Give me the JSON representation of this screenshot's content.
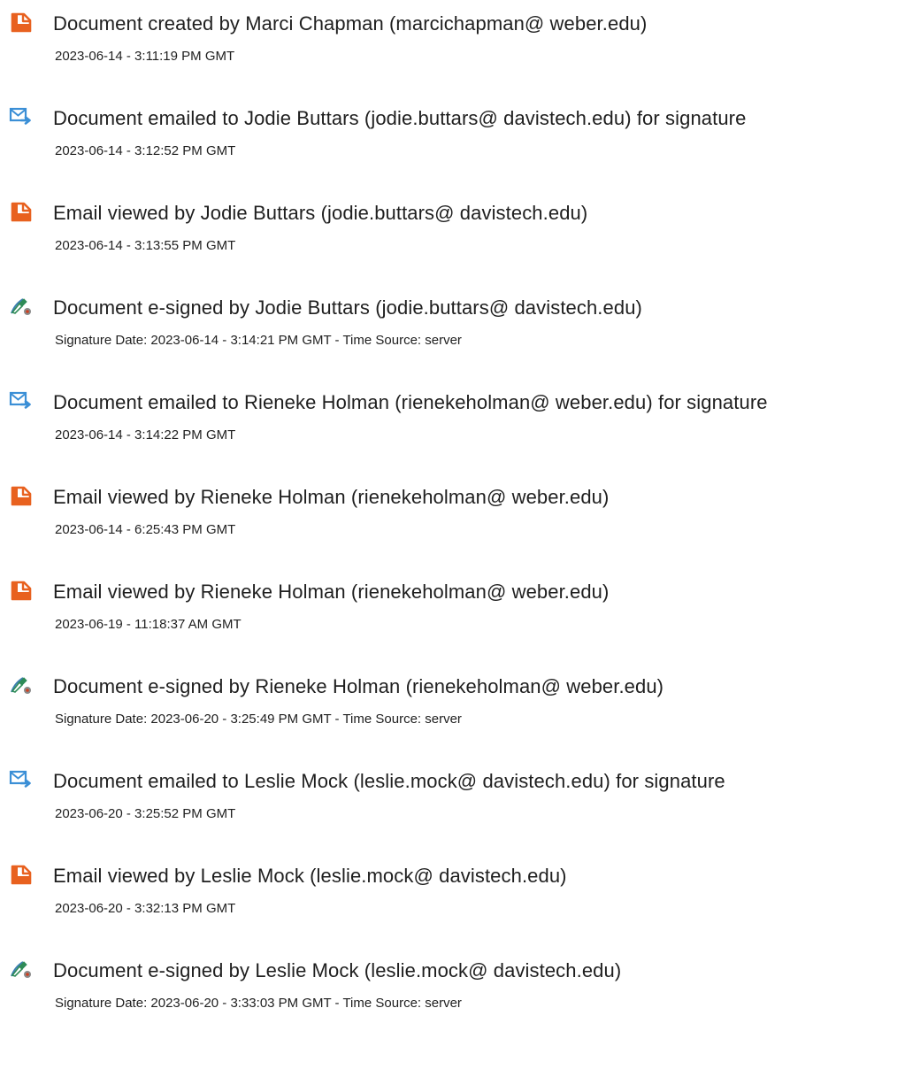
{
  "events": [
    {
      "icon": "document-icon",
      "title": "Document created by Marci Chapman (marcichapman@ weber.edu)",
      "date": "2023-06-14 - 3:11:19 PM GMT"
    },
    {
      "icon": "email-send-icon",
      "title": "Document emailed to Jodie Buttars (jodie.buttars@ davistech.edu) for signature",
      "date": "2023-06-14 - 3:12:52 PM GMT"
    },
    {
      "icon": "document-icon",
      "title": "Email viewed by Jodie Buttars (jodie.buttars@ davistech.edu)",
      "date": "2023-06-14 - 3:13:55 PM GMT"
    },
    {
      "icon": "pen-sign-icon",
      "title": "Document e-signed by Jodie Buttars (jodie.buttars@ davistech.edu)",
      "date": "Signature Date: 2023-06-14 - 3:14:21 PM GMT - Time Source: server"
    },
    {
      "icon": "email-send-icon",
      "title": "Document emailed to Rieneke Holman (rienekeholman@ weber.edu) for signature",
      "date": "2023-06-14 - 3:14:22 PM GMT"
    },
    {
      "icon": "document-icon",
      "title": "Email viewed by Rieneke Holman (rienekeholman@ weber.edu)",
      "date": "2023-06-14 - 6:25:43 PM GMT"
    },
    {
      "icon": "document-icon",
      "title": "Email viewed by Rieneke Holman (rienekeholman@ weber.edu)",
      "date": "2023-06-19 - 11:18:37 AM GMT"
    },
    {
      "icon": "pen-sign-icon",
      "title": "Document e-signed by Rieneke Holman (rienekeholman@ weber.edu)",
      "date": "Signature Date: 2023-06-20 - 3:25:49 PM GMT - Time Source: server"
    },
    {
      "icon": "email-send-icon",
      "title": "Document emailed to Leslie Mock (leslie.mock@ davistech.edu) for signature",
      "date": "2023-06-20 - 3:25:52 PM GMT"
    },
    {
      "icon": "document-icon",
      "title": "Email viewed by Leslie Mock (leslie.mock@ davistech.edu)",
      "date": "2023-06-20 - 3:32:13 PM GMT"
    },
    {
      "icon": "pen-sign-icon",
      "title": "Document e-signed by Leslie Mock (leslie.mock@ davistech.edu)",
      "date": "Signature Date: 2023-06-20 - 3:33:03 PM GMT - Time Source: server"
    }
  ],
  "colors": {
    "document_icon": "#e8611f",
    "email_icon": "#3b8fd6",
    "text": "#1f1f1f"
  }
}
